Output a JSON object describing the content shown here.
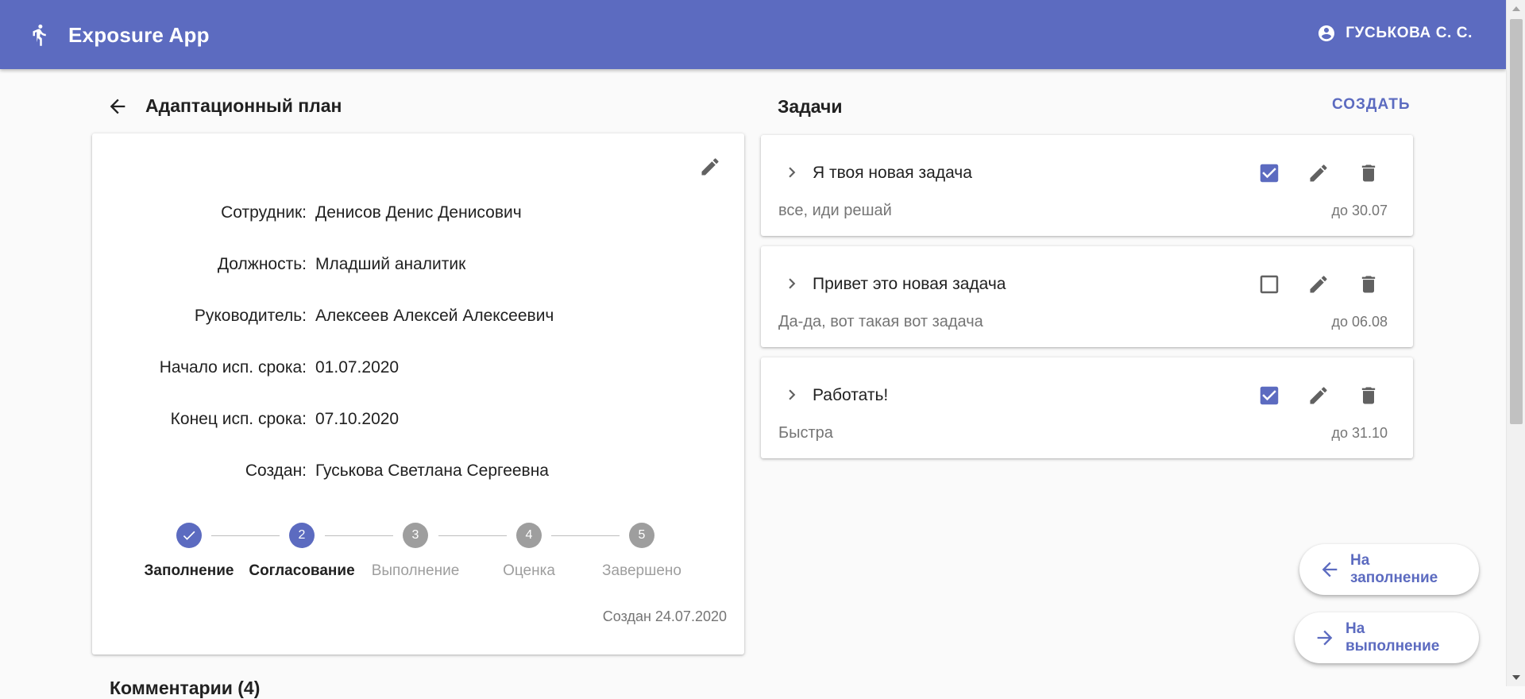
{
  "app": {
    "title": "Exposure App",
    "user_name": "ГУСЬКОВА С. С.",
    "accent_color": "#5c6bc0",
    "icons": {
      "logo": "person-walking-icon",
      "user": "account-circle-icon"
    }
  },
  "plan": {
    "title": "Адаптационный план",
    "fields": [
      {
        "label": "Сотрудник:",
        "value": "Денисов Денис Денисович"
      },
      {
        "label": "Должность:",
        "value": "Младший аналитик"
      },
      {
        "label": "Руководитель:",
        "value": "Алексеев Алексей Алексеевич"
      },
      {
        "label": "Начало исп. срока:",
        "value": "01.07.2020"
      },
      {
        "label": "Конец исп. срока:",
        "value": "07.10.2020"
      },
      {
        "label": "Создан:",
        "value": "Гуськова Светлана Сергеевна"
      }
    ],
    "steps": [
      {
        "number": "1",
        "label": "Заполнение",
        "state": "completed"
      },
      {
        "number": "2",
        "label": "Согласование",
        "state": "active"
      },
      {
        "number": "3",
        "label": "Выполнение",
        "state": "pending"
      },
      {
        "number": "4",
        "label": "Оценка",
        "state": "pending"
      },
      {
        "number": "5",
        "label": "Завершено",
        "state": "pending"
      }
    ],
    "created_date": "Создан 24.07.2020"
  },
  "comments": {
    "title": "Комментарии (4)"
  },
  "tasks": {
    "title": "Задачи",
    "create_label": "СОЗДАТЬ",
    "items": [
      {
        "title": "Я твоя новая задача",
        "description": "все, иди решай",
        "due": "до 30.07",
        "checked": true
      },
      {
        "title": "Привет это новая задача",
        "description": "Да-да, вот такая вот задача",
        "due": "до 06.08",
        "checked": false
      },
      {
        "title": "Работать!",
        "description": "Быстра",
        "due": "до 31.10",
        "checked": true
      }
    ]
  },
  "actions": {
    "back_label": "На заполнение",
    "next_label": "На выполнение"
  }
}
